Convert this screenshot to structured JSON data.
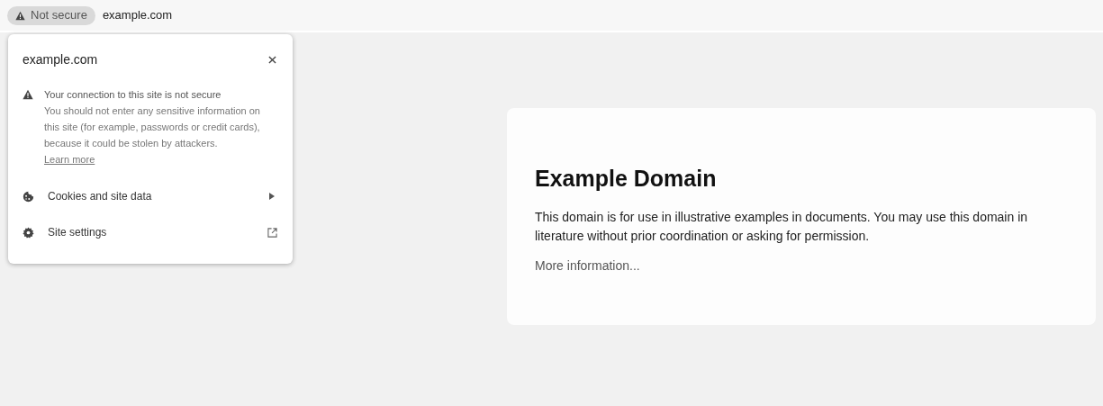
{
  "address_bar": {
    "security_chip": "Not secure",
    "url": "example.com"
  },
  "site_info_popup": {
    "title": "example.com",
    "warning": {
      "heading": "Your connection to this site is not secure",
      "body": "You should not enter any sensitive information on this site (for example, passwords or credit cards), because it could be stolen by attackers.",
      "link": "Learn more"
    },
    "items": [
      {
        "label": "Cookies and site data",
        "kind": "submenu"
      },
      {
        "label": "Site settings",
        "kind": "external"
      }
    ]
  },
  "page": {
    "heading": "Example Domain",
    "body": "This domain is for use in illustrative examples in documents. You may use this domain in literature without prior coordination or asking for permission.",
    "link": "More information..."
  }
}
